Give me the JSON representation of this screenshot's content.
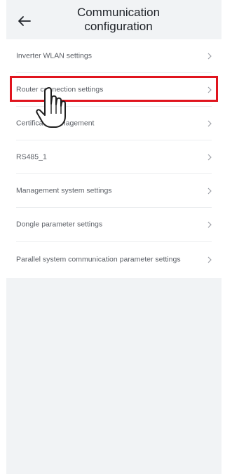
{
  "header": {
    "title": "Communication configuration",
    "back_icon": "arrow-left-icon"
  },
  "menu": {
    "items": [
      {
        "label": "Inverter WLAN settings"
      },
      {
        "label": "Router connection settings"
      },
      {
        "label": "Certificate management"
      },
      {
        "label": "RS485_1"
      },
      {
        "label": "Management system settings"
      },
      {
        "label": "Dongle parameter settings"
      },
      {
        "label": "Parallel system communication parameter settings"
      }
    ],
    "chevron_icon": "chevron-right-icon"
  },
  "annotation": {
    "highlight_color": "#e0141e",
    "pointer_icon": "hand-pointer-icon"
  }
}
